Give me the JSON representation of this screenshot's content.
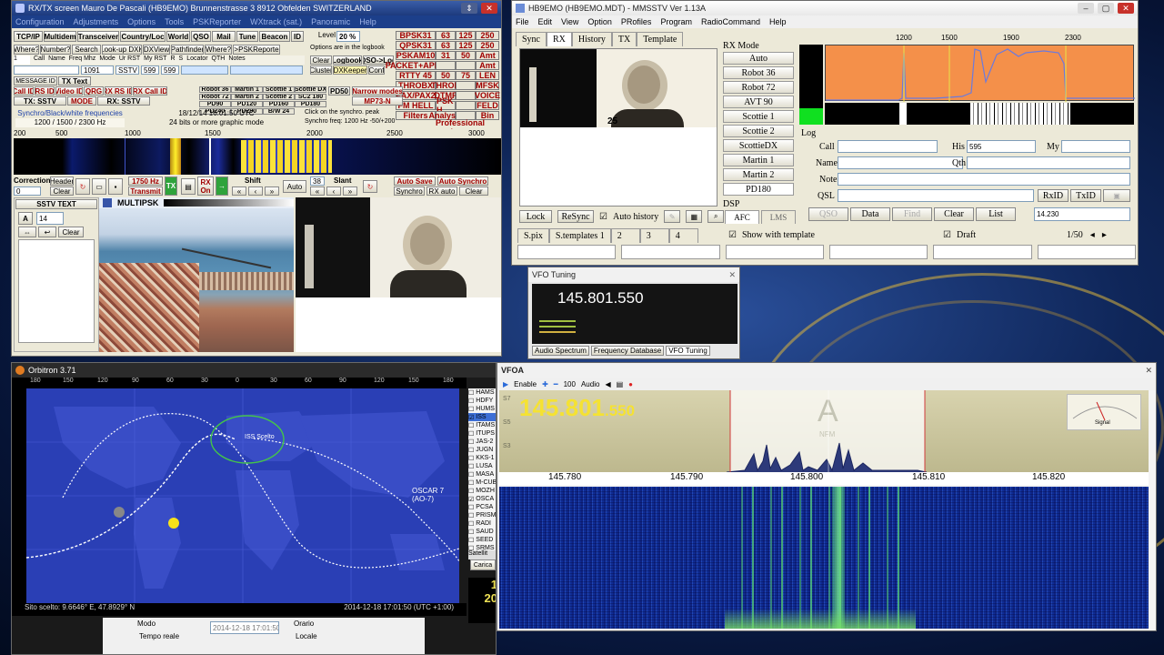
{
  "multipsk": {
    "title": "RX/TX screen  Mauro De Pascali (HB9EMO)  Brunnenstrasse 3  8912 Obfelden  SWITZERLAND",
    "menu": [
      "Configuration",
      "Adjustments",
      "Options",
      "Tools",
      "PSKReporter",
      "WXtrack (sat.)",
      "Panoramic",
      "Help"
    ],
    "top_buttons": [
      "TCP/IP",
      "Multidem",
      "Transceiver",
      "Country/Loc",
      "World",
      "QSO",
      "Mail",
      "Tune",
      "Beacon",
      "ID"
    ],
    "level_label": "Level",
    "level_value": "20 %",
    "row2_buttons": [
      "Where?",
      "Number?",
      "Search",
      "Look-up DXK",
      "DXView",
      "Pathfinder",
      "Where?",
      "->PSKReporter"
    ],
    "logbook_note": "Options are in the logbook",
    "log_headers": [
      "Call",
      "Name",
      "Freq Mhz",
      "Mode",
      "Ur RST",
      "My RST",
      "R",
      "S",
      "Locator",
      "QTH",
      "Notes"
    ],
    "log_freq": "1091",
    "log_mode": "SSTV",
    "log_ur_rst": "599",
    "log_my_rst": "599",
    "clear_label": "Clear",
    "logbook_label": "Logbook",
    "qso_log_label": "QSO->Log",
    "cluster_label": "Cluster",
    "dxkeeper_label": "DXKeeper",
    "conf_label": "Conf",
    "modes": [
      [
        "BPSK31",
        "63",
        "125",
        "250"
      ],
      [
        "QPSK31",
        "63",
        "125",
        "250"
      ],
      [
        "PSKAM10",
        "31",
        "50",
        "Amt"
      ],
      [
        "PACKET+APRS",
        "",
        "",
        "Amt"
      ],
      [
        "RTTY 45",
        "50",
        "75",
        "LEN"
      ],
      [
        "THROBX",
        "THROB",
        "",
        "MFSK"
      ],
      [
        "PAX/PAX2",
        "DTMF",
        "",
        "VOICE"
      ],
      [
        "FM HELL",
        "PSK H",
        "",
        "FELD"
      ],
      [
        "Filters",
        "Analysis",
        "",
        "Bin"
      ]
    ],
    "professional_modes": "Professional modes",
    "message_id_label": "MESSAGE ID",
    "tx_text_label": "TX Text",
    "call_id_labels": [
      "Call ID",
      "RS ID",
      "Video ID",
      "QRG"
    ],
    "rx_call_id": "RX Call ID",
    "rs_id": "RX RS ID",
    "tx_sstv": "TX: SSTV",
    "mode_label": "MODE",
    "rx_sstv": "RX: SSTV",
    "sstv_modes": [
      "Robot 36",
      "Martin 1",
      "Scottie 1",
      "Scottie DX",
      "Robot 72",
      "Martin 2",
      "Scottie 2",
      "SC2 180",
      "PD90",
      "PD120",
      "PD160",
      "PD180",
      "PD240",
      "PD290",
      "B/W 24"
    ],
    "pd50": "PD50",
    "narrow_modes": "Narrow modes",
    "mp73": "MP73-N",
    "synchro_label": "Synchro/Black/white frequencies",
    "synchro_value": "1200 / 1500 / 2300 Hz",
    "datetime": "18/12/14 16:01:50 UTC",
    "graphic_mode": "24 bits or more graphic mode",
    "click_note": "Click on the synchro. peak",
    "synchro_freq": "Synchro freq: 1200 Hz -50/+200",
    "scale": [
      "200",
      "500",
      "1000",
      "1500",
      "2000",
      "2500",
      "3000"
    ],
    "correction_label": "Correction",
    "correction_value": "0",
    "header_label": "Header",
    "clear2": "Clear",
    "freq_box": "1750 Hz",
    "transmit": "Transmit",
    "tx_label": "TX",
    "rx_on": "RX On",
    "shift_label": "Shift",
    "auto_label": "Auto",
    "slant_label": "Slant",
    "slant_value": "38",
    "auto_save": "Auto Save",
    "auto_synchro": "Auto Synchro",
    "synchro_btn": "Synchro",
    "rx_auto": "RX auto",
    "clear3": "Clear",
    "sstv_text": "SSTV TEXT",
    "sstv_a": "A",
    "sstv_size": "14",
    "clear4": "Clear",
    "multipsk_logo": "MULTIPSK"
  },
  "mmsstv": {
    "title": "HB9EMO (HB9EMO.MDT) - MMSSTV Ver 1.13A",
    "menu": [
      "File",
      "Edit",
      "View",
      "Option",
      "PRofiles",
      "Program",
      "RadioCommand",
      "Help"
    ],
    "tabs": [
      "Sync",
      "RX",
      "History",
      "TX",
      "Template"
    ],
    "rx_mode_label": "RX Mode",
    "modes": [
      "Auto",
      "Robot 36",
      "Robot 72",
      "AVT 90",
      "Scottie 1",
      "Scottie 2",
      "ScottieDX",
      "Martin 1",
      "Martin 2",
      "PD180"
    ],
    "dsp_label": "DSP",
    "afc": "AFC",
    "lms": "LMS",
    "freq_ticks": [
      "1200",
      "1500",
      "1900",
      "2300"
    ],
    "log_label": "Log",
    "call_label": "Call",
    "his_label": "His",
    "his_value": "595",
    "my_label": "My",
    "name_label": "Name",
    "qth_label": "Qth",
    "note_label": "Note",
    "qsl_label": "QSL",
    "rxid": "RxID",
    "txid": "TxID",
    "qso": "QSO",
    "data": "Data",
    "find": "Find",
    "clear": "Clear",
    "list": "List",
    "freq": "14.230",
    "lock": "Lock",
    "resync": "ReSync",
    "auto_history": "Auto history",
    "show_template": "Show with template",
    "draft": "Draft",
    "spix": "S.pix",
    "stemplates": "S.templates 1",
    "t2": "2",
    "t3": "3",
    "t4": "4",
    "page": "1/50",
    "stamp_number": "25"
  },
  "vfo_small": {
    "title": "VFO Tuning",
    "freq": "145.801.550",
    "tabs": [
      "Audio Spectrum",
      "Frequency Database",
      "VFO Tuning"
    ]
  },
  "orbitron": {
    "title": "Orbitron 3.71",
    "lon_ticks": [
      "180",
      "150",
      "120",
      "90",
      "60",
      "30",
      "0",
      "30",
      "60",
      "90",
      "120",
      "150",
      "180"
    ],
    "lat_ticks": [
      "90",
      "80",
      "70",
      "60",
      "50",
      "40",
      "30",
      "20",
      "10",
      "0",
      "10",
      "20",
      "30",
      "40",
      "50",
      "60",
      "70",
      "80",
      "90"
    ],
    "iss_label": "ISS Scelto",
    "oscar_label": "OSCAR 7 (AO-7)",
    "status_left": "Sito scelto: 9.6646° E, 47.8929° N",
    "status_right": "2014-12-18 17:01:50 (UTC +1:00)",
    "sat_list": [
      "HAMS",
      "HDFY",
      "HUMS",
      "ISS",
      "ITAMS",
      "ITUPS",
      "JAS-2",
      "JUGN",
      "KKS-1",
      "LUSA",
      "MASA",
      "M-CUB",
      "MOZH",
      "OSCA",
      "PCSA",
      "PRISM",
      "RADI",
      "SAUD",
      "SEED",
      "SRMS"
    ],
    "sat_tab": "Satellit",
    "carica": "Carica",
    "modo_label": "Modo",
    "tempo_reale": "Tempo reale",
    "datetime_field": "2014-12-18 17:01:50",
    "orario_label": "Orario",
    "locale_label": "Locale",
    "side_counter_1": "1",
    "side_counter_2": "20"
  },
  "vfoa": {
    "title": "VFOA",
    "enable": "Enable",
    "zoom": "100",
    "audio": "Audio",
    "freq_big": "145.801",
    "freq_small": ".550",
    "s_labels": [
      "S7",
      "S5",
      "S3"
    ],
    "mode_letter": "A",
    "mode_name": "NFM",
    "signal_label": "Signal",
    "ticks": [
      "145.780",
      "145.790",
      "145.800",
      "145.810",
      "145.820"
    ]
  },
  "colors": {
    "accent_red": "#a00000",
    "waterfall_blue": "#1636a8",
    "spectrum_orange": "#f4904a",
    "vfo_yellow": "#f5e232",
    "map_blue": "#2a3fb5"
  }
}
